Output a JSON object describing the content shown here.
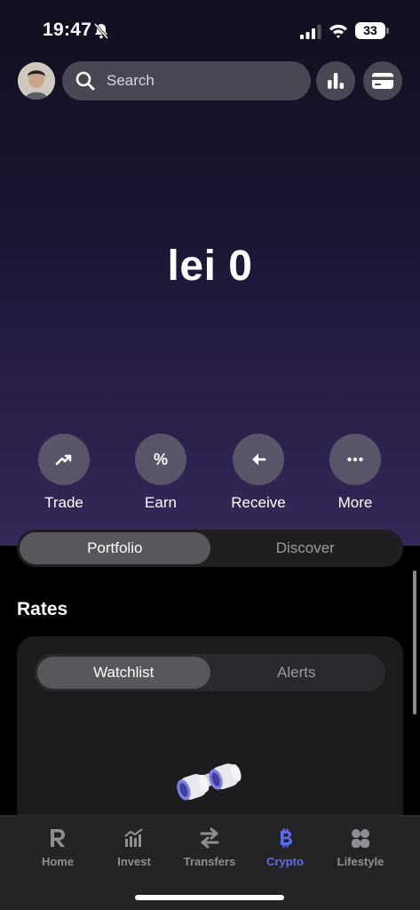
{
  "status_bar": {
    "time": "19:47",
    "battery": "33"
  },
  "header": {
    "search_placeholder": "Search"
  },
  "balance": "lei 0",
  "actions": [
    {
      "label": "Trade",
      "icon": "trend-up-icon"
    },
    {
      "label": "Earn",
      "icon": "percent-icon",
      "glyph": "%"
    },
    {
      "label": "Receive",
      "icon": "arrow-left-icon"
    },
    {
      "label": "More",
      "icon": "more-icon"
    }
  ],
  "main_tabs": [
    {
      "label": "Portfolio",
      "active": true
    },
    {
      "label": "Discover",
      "active": false
    }
  ],
  "rates": {
    "title": "Rates",
    "tabs": [
      {
        "label": "Watchlist",
        "active": true
      },
      {
        "label": "Alerts",
        "active": false
      }
    ]
  },
  "tabbar": [
    {
      "label": "Home",
      "icon": "revolut-r-icon",
      "active": false
    },
    {
      "label": "Invest",
      "icon": "invest-chart-icon",
      "active": false
    },
    {
      "label": "Transfers",
      "icon": "transfer-arrows-icon",
      "active": false
    },
    {
      "label": "Crypto",
      "icon": "bitcoin-icon",
      "active": true
    },
    {
      "label": "Lifestyle",
      "icon": "lifestyle-icon",
      "active": false
    }
  ],
  "colors": {
    "accent": "#5b6cf0",
    "hero_top": "#120f20",
    "hero_bottom": "#35285a"
  }
}
